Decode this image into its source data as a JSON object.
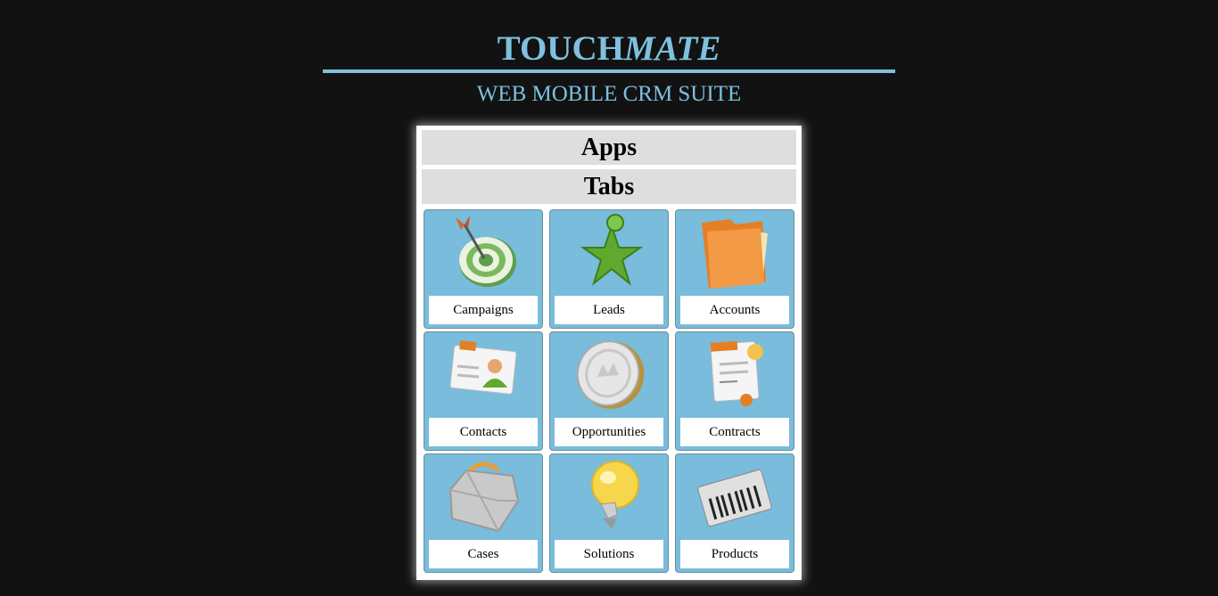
{
  "header": {
    "brand_touch": "TOUCH",
    "brand_mate": "MATE",
    "subtitle": "WEB MOBILE CRM SUITE"
  },
  "menu": {
    "apps_label": "Apps",
    "tabs_label": "Tabs"
  },
  "tiles": [
    {
      "label": "Campaigns",
      "icon": "target-dart-icon"
    },
    {
      "label": "Leads",
      "icon": "star-person-icon"
    },
    {
      "label": "Accounts",
      "icon": "folder-icon"
    },
    {
      "label": "Contacts",
      "icon": "contact-card-icon"
    },
    {
      "label": "Opportunities",
      "icon": "coin-icon"
    },
    {
      "label": "Contracts",
      "icon": "contract-document-icon"
    },
    {
      "label": "Cases",
      "icon": "toolbox-icon"
    },
    {
      "label": "Solutions",
      "icon": "lightbulb-icon"
    },
    {
      "label": "Products",
      "icon": "barcode-icon"
    }
  ],
  "colors": {
    "accent": "#7ec0de",
    "tile_bg": "#79bcdb",
    "page_bg": "#121212"
  }
}
